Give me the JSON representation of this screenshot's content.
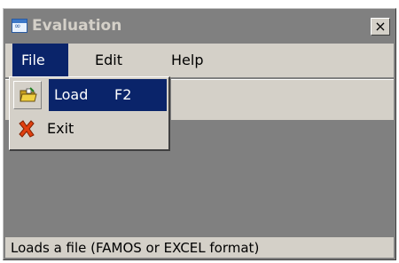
{
  "window": {
    "title": "Evaluation",
    "close_glyph": "×",
    "icon": "app-icon",
    "icon_glyph": "∞"
  },
  "menubar": {
    "items": [
      {
        "label": "File",
        "active": true
      },
      {
        "label": "Edit",
        "active": false
      },
      {
        "label": "Help",
        "active": false
      }
    ]
  },
  "file_menu": {
    "items": [
      {
        "label": "Load",
        "shortcut": "F2",
        "icon": "folder-open-icon",
        "highlighted": true
      },
      {
        "label": "Exit",
        "icon": "exit-icon",
        "highlighted": false
      }
    ]
  },
  "statusbar": {
    "text": "Loads a file  (FAMOS or EXCEL format)"
  },
  "colors": {
    "highlight": "#0a246a",
    "face": "#d4d0c8",
    "client": "#808080"
  }
}
